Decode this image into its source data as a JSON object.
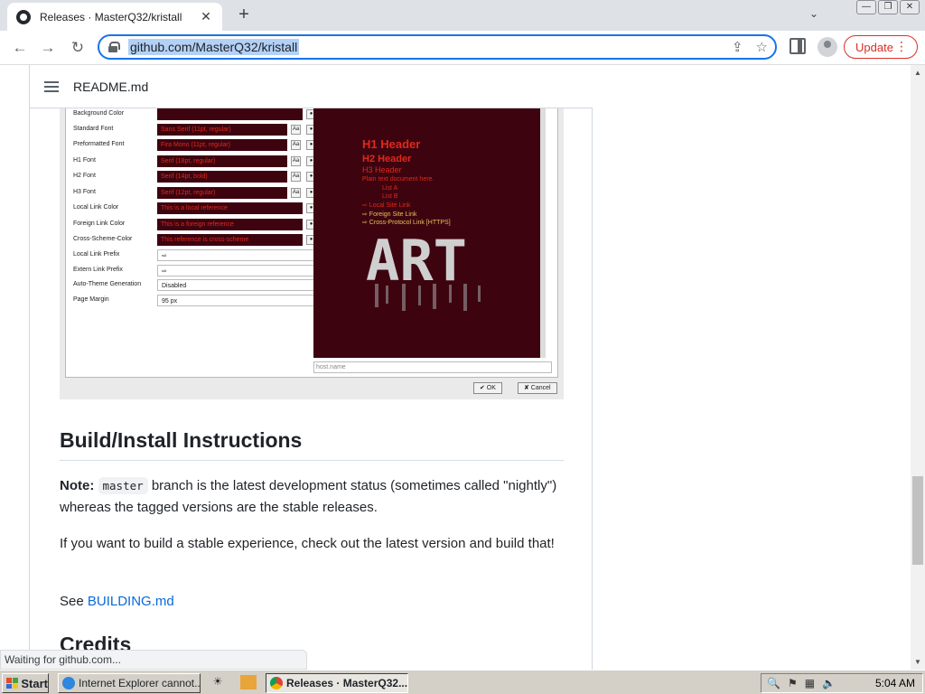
{
  "browser": {
    "tab_title": "Releases · MasterQ32/kristall",
    "tab_close": "✕",
    "new_tab": "+",
    "tab_search": "⌄",
    "url": "github.com/MasterQ32/kristall",
    "update_label": "Update",
    "back": "←",
    "forward": "→",
    "reload": "↻",
    "share": "⇪",
    "star": "☆",
    "menu": "⋮"
  },
  "window_controls": [
    "—",
    "❐",
    "✕"
  ],
  "readme": {
    "title": "README.md"
  },
  "screenshot": {
    "rows": [
      {
        "label": "Background Color",
        "value": ""
      },
      {
        "label": "Standard Font",
        "value": "Sans Serif (11pt, regular)"
      },
      {
        "label": "Preformatted Font",
        "value": "Fira Mono (11pt, regular)"
      },
      {
        "label": "H1 Font",
        "value": "Serif (18pt, regular)"
      },
      {
        "label": "H2 Font",
        "value": "Serif (14pt, bold)"
      },
      {
        "label": "H3 Font",
        "value": "Serif (12pt, regular)"
      },
      {
        "label": "Local Link Color",
        "value": "This is a local reference"
      },
      {
        "label": "Foreign Link Color",
        "value": "This is a foreign reference"
      },
      {
        "label": "Cross-Scheme-Color",
        "value": "This reference is cross-scheme"
      },
      {
        "label": "Local Link Prefix",
        "value": "⇨"
      },
      {
        "label": "Extern Link Prefix",
        "value": "⇨"
      },
      {
        "label": "Auto-Theme Generation",
        "value": "Disabled"
      },
      {
        "label": "Page Margin",
        "value": "95 px"
      }
    ],
    "preview": {
      "h1": "H1 Header",
      "h2": "H2 Header",
      "h3": "H3 Header",
      "plain": "Plain text document here.",
      "list_a": "List A",
      "list_b": "List B",
      "local": "⇨ Local Site Link",
      "foreign": "⇨ Foreign Site Link",
      "cross": "⇨ Cross-Protocol Link [HTTPS]",
      "art": "ART"
    },
    "hostname_placeholder": "host.name",
    "ok": "✔ OK",
    "cancel": "✘ Cancel"
  },
  "section": {
    "heading": "Build/Install Instructions",
    "note_label": "Note:",
    "note_code": "master",
    "note_rest": " branch is the latest development status (sometimes called \"nightly\") whereas the tagged versions are the stable releases.",
    "para2": "If you want to build a stable experience, check out the latest version and build that!",
    "see_label": "See ",
    "see_link": "BUILDING.md",
    "next_heading": "Credits"
  },
  "status_bubble": "Waiting for github.com...",
  "taskbar": {
    "start": "Start",
    "tasks": [
      "Internet Explorer cannot...",
      "Releases · MasterQ32..."
    ],
    "clock": "5:04 AM"
  },
  "colors": {
    "accent": "#1a73e8",
    "update": "#d93025",
    "link": "#0969da",
    "preview_bg": "#3d0410",
    "preview_fg": "#e0291a"
  }
}
